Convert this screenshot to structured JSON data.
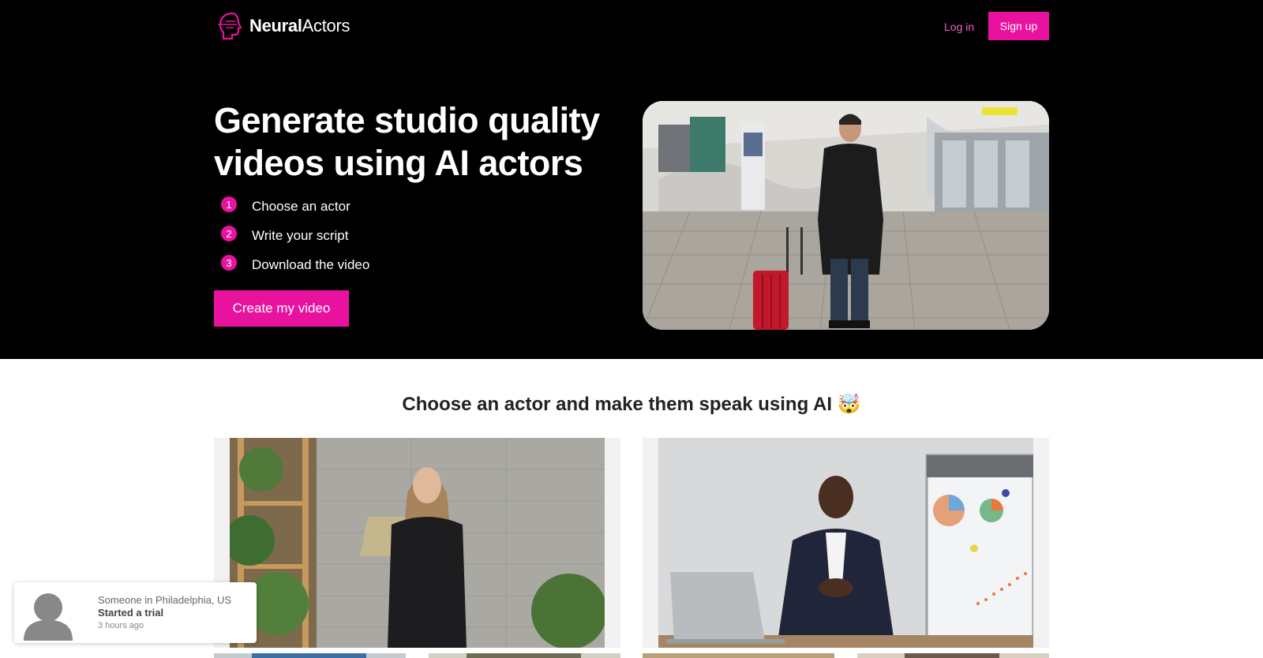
{
  "brand": {
    "name_bold": "Neural",
    "name_regular": "Actors",
    "logo_icon": "head-logo-icon",
    "accent": "#e9129e"
  },
  "nav": {
    "login": "Log in",
    "signup": "Sign up"
  },
  "hero": {
    "title": "Generate studio quality videos using AI actors",
    "steps": [
      {
        "num": "1",
        "text": "Choose an actor"
      },
      {
        "num": "2",
        "text": "Write your script"
      },
      {
        "num": "3",
        "text": "Download the video"
      }
    ],
    "cta": "Create my video"
  },
  "actors_section": {
    "title": "Choose an actor and make them speak using AI 🤯"
  },
  "toast": {
    "line1": "Someone in Philadelphia, US",
    "line2": "Started a trial",
    "line3": "3 hours ago",
    "avatar_icon": "person-avatar-icon"
  }
}
